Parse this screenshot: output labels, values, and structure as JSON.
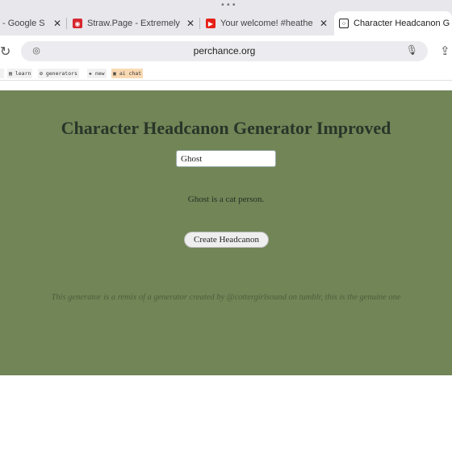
{
  "browser": {
    "tabs": [
      {
        "title": "- Google S",
        "favicon": "google-icon",
        "active": false
      },
      {
        "title": "Straw.Page - Extremely",
        "favicon": "strawpage-icon",
        "active": false
      },
      {
        "title": "Your welcome! #heathe",
        "favicon": "youtube-icon",
        "active": false
      },
      {
        "title": "Character Headcanon G",
        "favicon": "dice-icon",
        "active": true
      }
    ],
    "url": "perchance.org",
    "bookmarks": [
      "learn",
      "generators",
      "new",
      "ai chat"
    ]
  },
  "page": {
    "heading": "Character Headcanon Generator Improved",
    "name_input_value": "Ghost",
    "result_text": "Ghost is a cat person.",
    "button_label": "Create Headcanon",
    "credit_text": "This generator is a remix of a generator created by @cottergirlsound on tumblr, this is the genuine one",
    "background_color": "#718557"
  }
}
